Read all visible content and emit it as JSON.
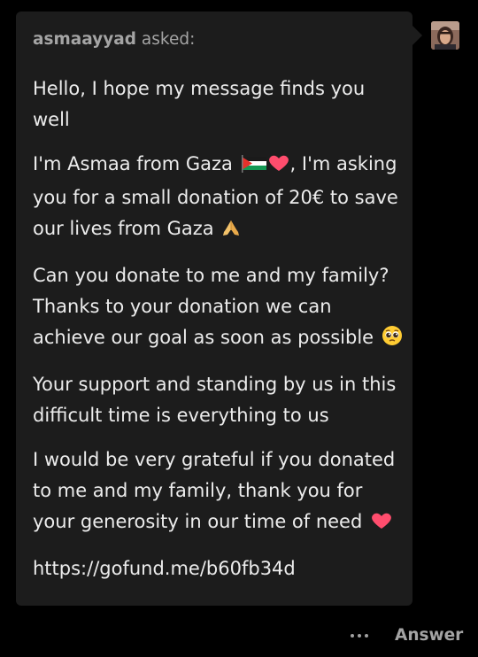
{
  "ask": {
    "asker_name": "asmaayyad",
    "asker_suffix": " asked:",
    "paragraphs": [
      {
        "text": "Hello, I hope my message finds you well",
        "emoji": ""
      },
      {
        "text": "I'm Asmaa from Gaza ",
        "emoji": "palestine-flag-heart",
        "after": ", I'm asking you for a small donation of 20€ to save our lives from Gaza ",
        "emoji2": "folded-hands"
      },
      {
        "text": "Can you donate to me and my family? Thanks to your donation we can achieve our goal as soon as possible ",
        "emoji": "pleading-face"
      },
      {
        "text": "Your support and standing by us in this difficult time is everything to us",
        "emoji": ""
      },
      {
        "text": "I would be very grateful if you donated to me and my family, thank you for your generosity in our time of need ",
        "emoji": "red-heart"
      },
      {
        "text": "https://gofund.me/b60fb34d",
        "emoji": ""
      }
    ]
  },
  "footer": {
    "more_icon": "ellipsis-icon",
    "answer_label": "Answer"
  },
  "colors": {
    "background": "#000000",
    "card": "#1c1c1c",
    "text": "#ececec",
    "muted": "#a4a4a4",
    "heart": "#ff4d6d"
  }
}
